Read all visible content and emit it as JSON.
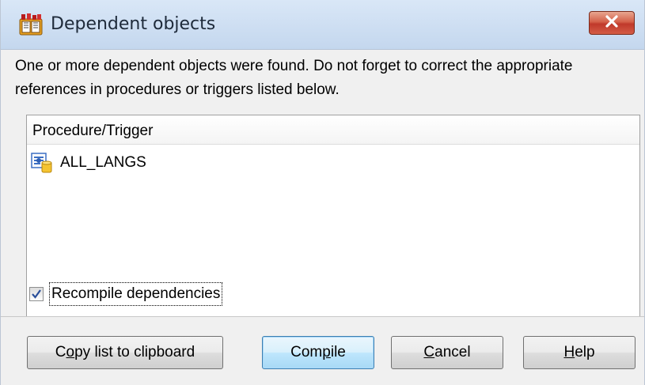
{
  "window": {
    "title": "Dependent objects",
    "close_glyph": "✖"
  },
  "message": {
    "text": "One or more dependent objects were found. Do not forget to correct the appropriate references in procedures or triggers listed below."
  },
  "list": {
    "column_header": "Procedure/Trigger",
    "items": [
      {
        "label": "ALL_LANGS",
        "icon": "procedure-icon"
      }
    ]
  },
  "options": {
    "recompile_label": "Recompile dependencies",
    "recompile_checked": true
  },
  "buttons": {
    "copy_pre": "C",
    "copy_mnemonic": "o",
    "copy_post": "py list to clipboard",
    "compile_pre": "Com",
    "compile_mnemonic": "p",
    "compile_post": "ile",
    "cancel_mnemonic": "C",
    "cancel_post": "ancel",
    "help_mnemonic": "H",
    "help_post": "elp"
  },
  "colors": {
    "titlebar": "#c4d7ee",
    "close_button": "#c0392b",
    "default_button_border": "#3c7fb1",
    "checkmark": "#2a4f9a"
  }
}
